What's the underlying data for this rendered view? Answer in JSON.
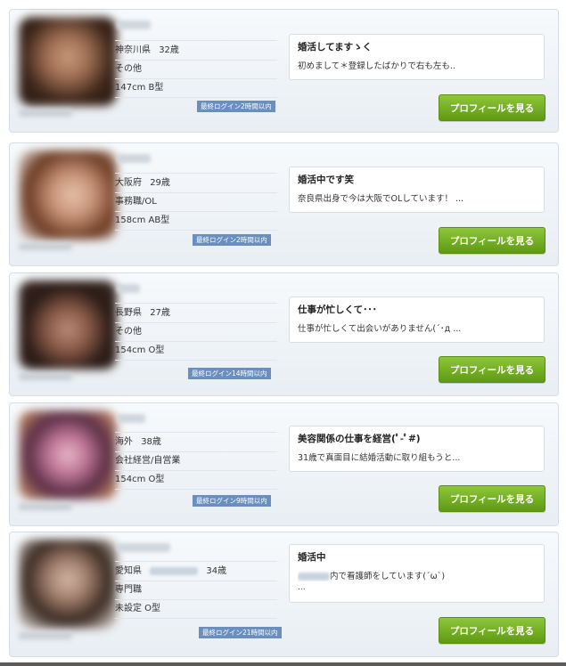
{
  "profiles": [
    {
      "location": "神奈川県",
      "age": "32歳",
      "occupation": "その他",
      "body": "147cm B型",
      "login": "最終ログイン2時間以内",
      "message_title": "婚活してますゝく",
      "message_body": "初めまして＊登録したばかりで右も左も..",
      "button": "プロフィールを見る",
      "photo_colors": [
        "#3a2418",
        "#c99a7c"
      ]
    },
    {
      "location": "大阪府",
      "age": "29歳",
      "occupation": "事務職/OL",
      "body": "158cm AB型",
      "login": "最終ログイン2時間以内",
      "message_title": "婚活中です笑",
      "message_body": "奈良県出身で今は大阪でOLしています！ ...",
      "button": "プロフィールを見る",
      "photo_colors": [
        "#6b3a22",
        "#e6c2a8"
      ]
    },
    {
      "location": "長野県",
      "age": "27歳",
      "occupation": "その他",
      "body": "154cm O型",
      "login": "最終ログイン14時間以内",
      "message_title": "仕事が忙しくて･･･",
      "message_body": "仕事が忙しくて出会いがありません(´･д ...",
      "button": "プロフィールを見る",
      "photo_colors": [
        "#2a1b16",
        "#b98c78"
      ]
    },
    {
      "location": "海外",
      "age": "38歳",
      "occupation": "会社経営/自営業",
      "body": "154cm O型",
      "login": "最終ログイン9時間以内",
      "message_title": "美容関係の仕事を経営(ﾟ-ﾟ#)",
      "message_body": "31歳で真面目に結婚活動に取り組もうと...",
      "button": "プロフィールを見る",
      "photo_colors": [
        "#5b2e46",
        "#e8b8c8"
      ]
    },
    {
      "location": "愛知県",
      "age": "34歳",
      "occupation": "専門職",
      "body": "未設定 O型",
      "login": "最終ログイン21時間以内",
      "message_title": "婚活中",
      "message_body": "内で看護師をしています(´ω`)",
      "message_more": "...",
      "button": "プロフィールを見る",
      "photo_colors": [
        "#3a2a22",
        "#d2b6a4"
      ]
    }
  ]
}
